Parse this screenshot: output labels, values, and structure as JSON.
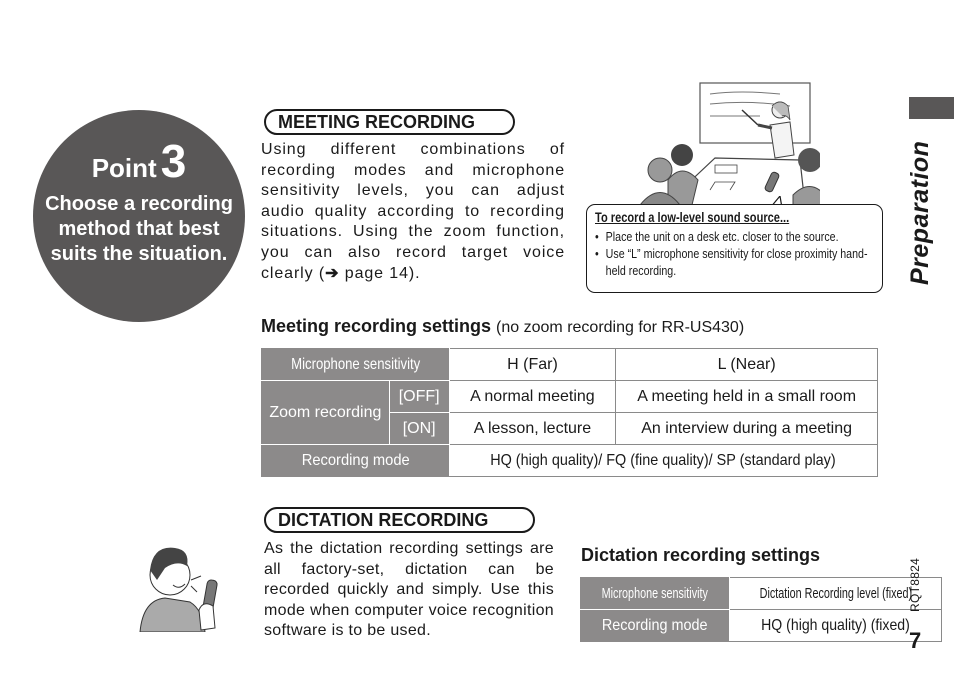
{
  "point": {
    "word": "Point",
    "number": "3",
    "subtitle": "Choose a recording method that best suits the situation."
  },
  "meeting": {
    "heading": "MEETING RECORDING",
    "text_before_arrow": "Using different combinations of recording modes and microphone sensitivity levels, you can adjust audio quality according to recording situations. Using the zoom function, you can also record target voice clearly (",
    "arrow_icon": "right-arrow-icon",
    "text_after_arrow": " page 14).",
    "callout": {
      "title": "To record a low-level sound source...",
      "bullets": [
        "Place the unit on a desk etc. closer to the source.",
        "Use “L” microphone sensitivity for close proximity hand-held recording."
      ]
    },
    "illustration": "meeting-room-illustration"
  },
  "side": {
    "section_label": "Preparation",
    "doc_code": "RQT8824",
    "page_number": "7"
  },
  "meeting_settings": {
    "heading": "Meeting recording settings",
    "note": "(no zoom recording for RR-US430)",
    "table": {
      "mic_sensitivity_label": "Microphone sensitivity",
      "col_h": "H (Far)",
      "col_l": "L (Near)",
      "zoom_label": "Zoom recording",
      "zoom_off": "[OFF]",
      "zoom_on": "[ON]",
      "off_h": "A normal meeting",
      "off_l": "A meeting held in a small room",
      "on_h": "A lesson, lecture",
      "on_l": "An interview during a meeting",
      "mode_label": "Recording mode",
      "mode_value": "HQ (high quality)/ FQ (fine quality)/ SP (standard play)"
    }
  },
  "dictation": {
    "heading": "DICTATION RECORDING",
    "text": "As the dictation recording settings are all factory-set, dictation can be recorded quickly and simply. Use this mode when computer voice recognition software is to be used.",
    "illustration": "man-speaking-into-recorder-illustration"
  },
  "dictation_settings": {
    "heading": "Dictation recording settings",
    "table": {
      "mic_sensitivity_label": "Microphone sensitivity",
      "mic_sensitivity_value": "Dictation Recording level (fixed)",
      "mode_label": "Recording mode",
      "mode_value": "HQ (high quality) (fixed)"
    }
  }
}
